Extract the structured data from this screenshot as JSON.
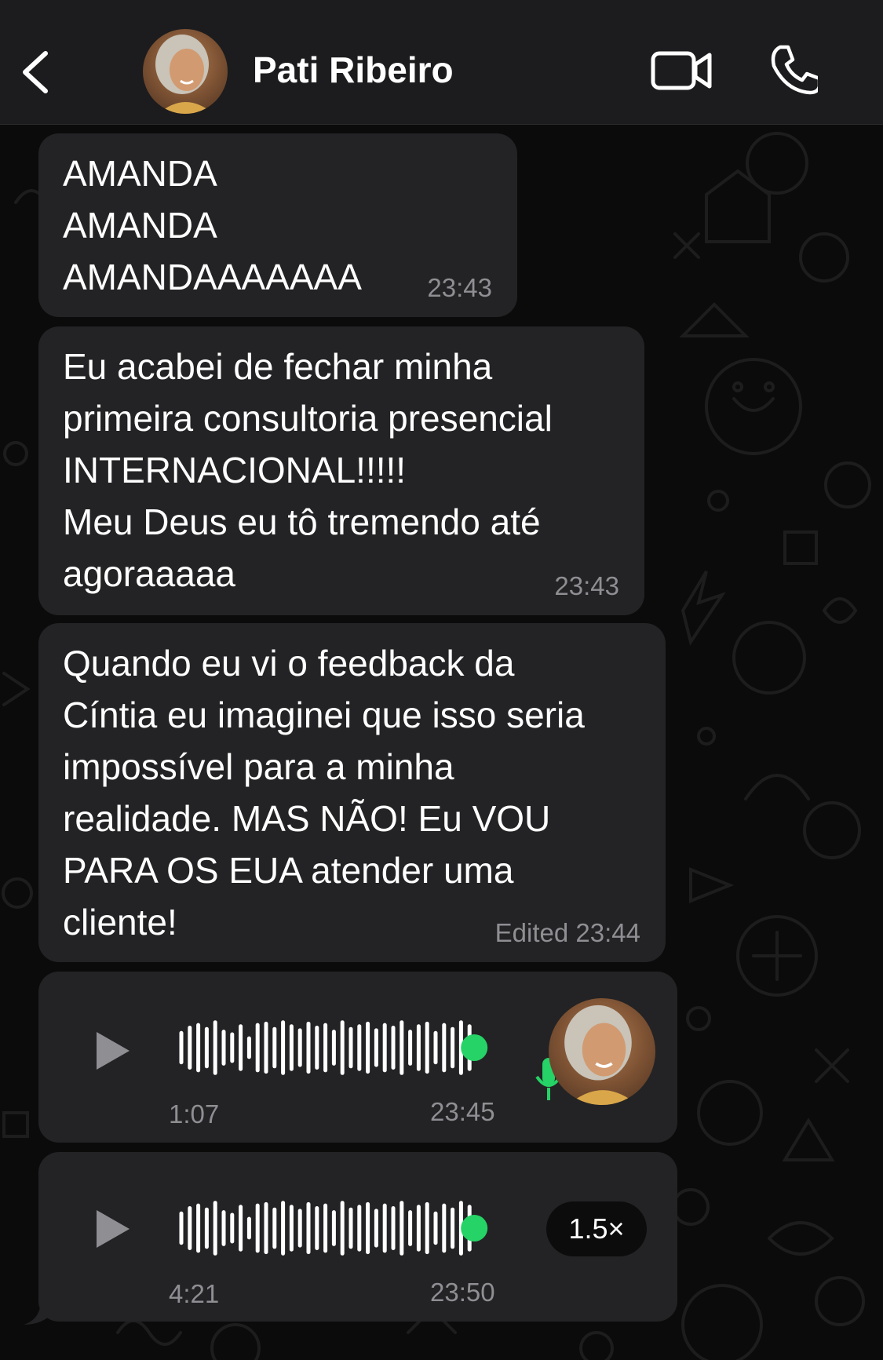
{
  "header": {
    "contact_name": "Pati Ribeiro"
  },
  "icons": {
    "back": "chevron-left-icon",
    "video": "video-camera-icon",
    "call": "phone-icon",
    "play": "play-icon",
    "mic": "microphone-icon"
  },
  "colors": {
    "background": "#0b0b0b",
    "header": "#1c1c1e",
    "bubble": "#232325",
    "accent_green": "#25d366",
    "meta_text": "#8e8e93"
  },
  "messages": [
    {
      "text": "AMANDA\nAMANDA\nAMANDAAAAAAA",
      "time": "23:43"
    },
    {
      "text": "Eu acabei de fechar minha\nprimeira consultoria presencial\nINTERNACIONAL!!!!!\nMeu Deus eu tô tremendo até\nagoraaaaa",
      "time": "23:43"
    },
    {
      "text": "Quando eu vi o feedback da\nCíntia eu imaginei que isso seria\nimpossível para a minha\nrealidade. MAS NÃO! Eu VOU\nPARA OS EUA atender uma\ncliente!",
      "time": "Edited 23:44"
    }
  ],
  "voice_messages": [
    {
      "duration": "1:07",
      "time": "23:45"
    },
    {
      "duration": "4:21",
      "time": "23:50",
      "speed": "1.5×"
    }
  ]
}
